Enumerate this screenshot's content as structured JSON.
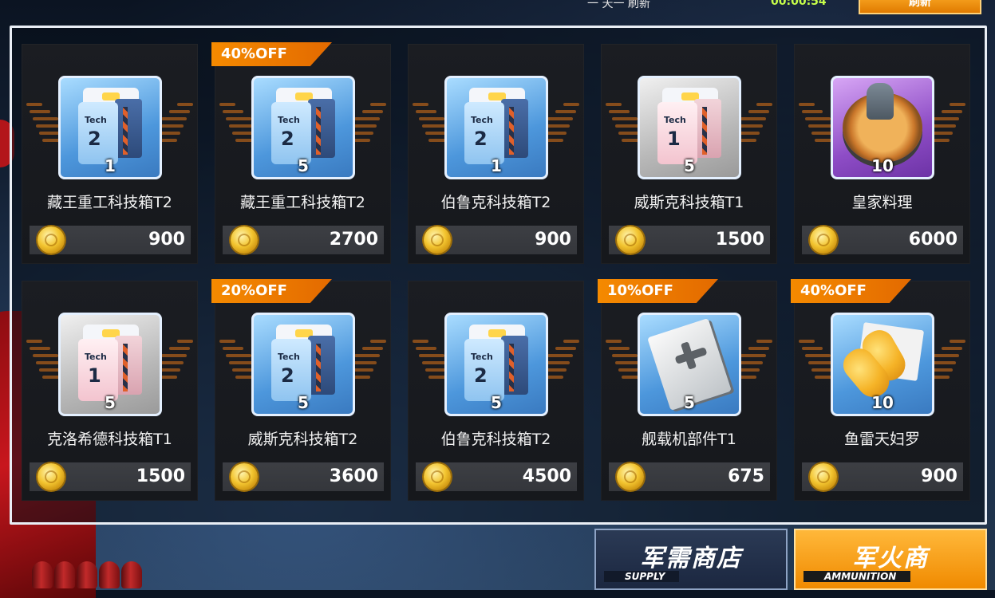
{
  "top_bar": {
    "text": "一 天一 刷新",
    "currency": "00:00:54",
    "refresh_button": "刷新"
  },
  "rows": [
    [
      {
        "name": "藏王重工科技箱T2",
        "qty": "1",
        "price": "900",
        "discount": "",
        "icon": "tech-box-t2-icon",
        "tech": "2",
        "frame": "blue"
      },
      {
        "name": "藏王重工科技箱T2",
        "qty": "5",
        "price": "2700",
        "discount": "40%OFF",
        "icon": "tech-box-t2-icon",
        "tech": "2",
        "frame": "blue"
      },
      {
        "name": "伯鲁克科技箱T2",
        "qty": "1",
        "price": "900",
        "discount": "",
        "icon": "tech-box-t2-icon",
        "tech": "2",
        "frame": "blue"
      },
      {
        "name": "威斯克科技箱T1",
        "qty": "5",
        "price": "1500",
        "discount": "",
        "icon": "tech-box-t1-icon",
        "tech": "1",
        "frame": "gray"
      },
      {
        "name": "皇家料理",
        "qty": "10",
        "price": "6000",
        "discount": "",
        "icon": "royal-cuisine-icon",
        "tech": "",
        "frame": "purple"
      }
    ],
    [
      {
        "name": "克洛希德科技箱T1",
        "qty": "5",
        "price": "1500",
        "discount": "",
        "icon": "tech-box-t1-icon",
        "tech": "1",
        "frame": "gray"
      },
      {
        "name": "威斯克科技箱T2",
        "qty": "5",
        "price": "3600",
        "discount": "20%OFF",
        "icon": "tech-box-t2-icon",
        "tech": "2",
        "frame": "blue"
      },
      {
        "name": "伯鲁克科技箱T2",
        "qty": "5",
        "price": "4500",
        "discount": "",
        "icon": "tech-box-t2-icon",
        "tech": "2",
        "frame": "blue"
      },
      {
        "name": "舰载机部件T1",
        "qty": "5",
        "price": "675",
        "discount": "10%OFF",
        "icon": "aircraft-parts-icon",
        "tech": "",
        "frame": "blue"
      },
      {
        "name": "鱼雷天妇罗",
        "qty": "10",
        "price": "900",
        "discount": "40%OFF",
        "icon": "torpedo-tempura-icon",
        "tech": "",
        "frame": "blue"
      }
    ]
  ],
  "tabs": {
    "supply": {
      "label": "军需商店",
      "sub": "SUPPLY"
    },
    "ammo": {
      "label": "军火商",
      "sub": "AMMUNITION"
    }
  },
  "colors": {
    "accent": "#f08a00",
    "panel_border": "#e9eef5",
    "coin": "#f3c530"
  }
}
